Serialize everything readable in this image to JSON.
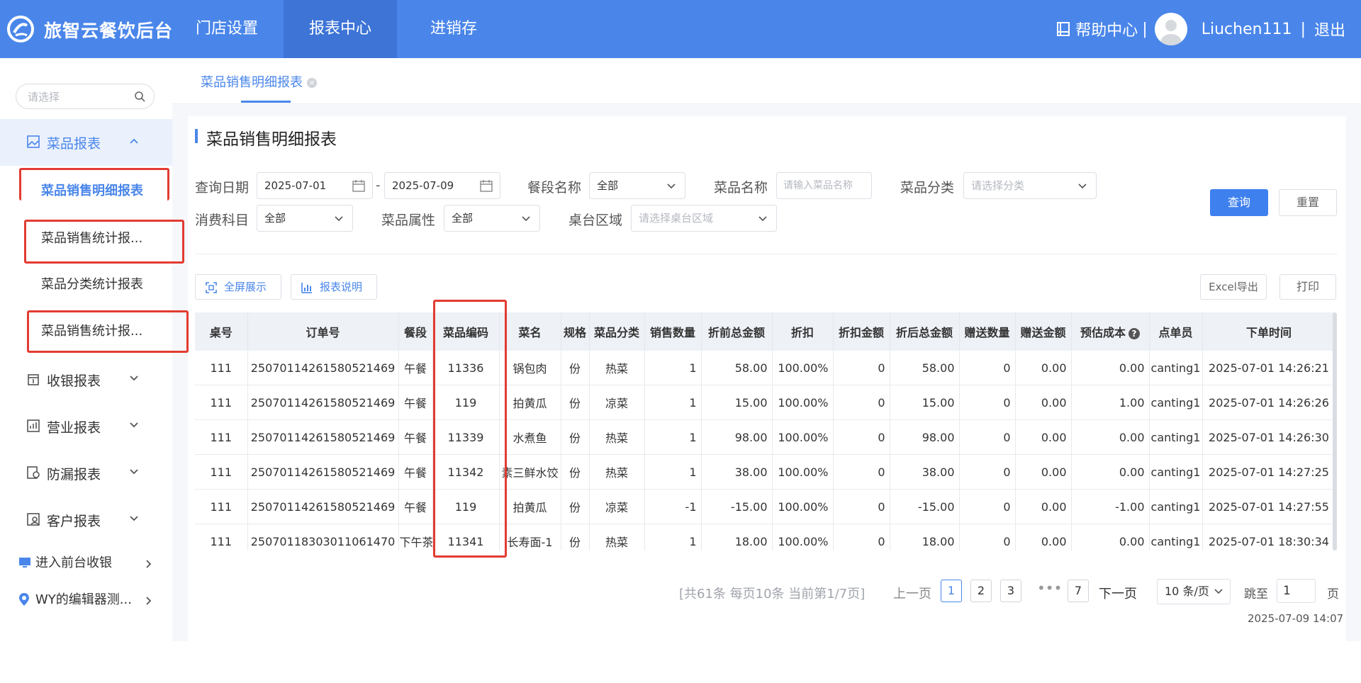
{
  "header": {
    "brand": "旅智云餐饮后台",
    "nav": [
      {
        "label": "门店设置"
      },
      {
        "label": "报表中心"
      },
      {
        "label": "进销存"
      }
    ],
    "help": "帮助中心",
    "sep1": "|",
    "username": "Liuchen111",
    "sep2": "|",
    "logout": "退出",
    "brand_color": "#4a86ea"
  },
  "sidebar": {
    "search_placeholder": "请选择",
    "groups": [
      {
        "label": "菜品报表",
        "icon": "image-report-icon",
        "expanded": true,
        "items": [
          "菜品销售明细报表",
          "菜品销售统计报...",
          "菜品分类统计报表",
          "菜品销售统计报..."
        ]
      },
      {
        "label": "收银报表",
        "icon": "cashier-report-icon"
      },
      {
        "label": "营业报表",
        "icon": "business-report-icon"
      },
      {
        "label": "防漏报表",
        "icon": "leak-report-icon"
      },
      {
        "label": "客户报表",
        "icon": "customer-report-icon"
      }
    ],
    "links": [
      {
        "label": "进入前台收银",
        "icon": "monitor-icon"
      },
      {
        "label": "WY的编辑器测...",
        "icon": "location-pin-icon"
      }
    ]
  },
  "tabs": [
    {
      "label": "菜品销售明细报表"
    }
  ],
  "page": {
    "title": "菜品销售明细报表",
    "filters": {
      "date_label": "查询日期",
      "date_start": "2025-07-01",
      "date_sep": "-",
      "date_end": "2025-07-09",
      "meal_label": "餐段名称",
      "meal_value": "全部",
      "dish_label": "菜品名称",
      "dish_placeholder": "请输入菜品名称",
      "category_label": "菜品分类",
      "category_placeholder": "请选择分类",
      "subject_label": "消费科目",
      "subject_value": "全部",
      "attr_label": "菜品属性",
      "attr_value": "全部",
      "area_label": "桌台区域",
      "area_placeholder": "请选择桌台区域"
    },
    "query_button": "查询",
    "reset_button": "重置",
    "fullscreen_button": "全屏展示",
    "explain_button": "报表说明",
    "excel_button": "Excel导出",
    "print_button": "打印"
  },
  "table": {
    "columns": [
      "桌号",
      "订单号",
      "餐段",
      "菜品编码",
      "菜名",
      "规格",
      "菜品分类",
      "销售数量",
      "折前总金额",
      "折扣",
      "折扣金额",
      "折后总金额",
      "赠送数量",
      "赠送金额",
      "预估成本",
      "点单员",
      "下单时间"
    ],
    "rows": [
      [
        "111",
        "25070114261580521469",
        "午餐",
        "11336",
        "锅包肉",
        "份",
        "热菜",
        "1",
        "58.00",
        "100.00%",
        "0",
        "58.00",
        "0",
        "0.00",
        "0.00",
        "canting1",
        "2025-07-01 14:26:21"
      ],
      [
        "111",
        "25070114261580521469",
        "午餐",
        "119",
        "拍黄瓜",
        "份",
        "凉菜",
        "1",
        "15.00",
        "100.00%",
        "0",
        "15.00",
        "0",
        "0.00",
        "1.00",
        "canting1",
        "2025-07-01 14:26:26"
      ],
      [
        "111",
        "25070114261580521469",
        "午餐",
        "11339",
        "水煮鱼",
        "份",
        "热菜",
        "1",
        "98.00",
        "100.00%",
        "0",
        "98.00",
        "0",
        "0.00",
        "0.00",
        "canting1",
        "2025-07-01 14:26:30"
      ],
      [
        "111",
        "25070114261580521469",
        "午餐",
        "11342",
        "素三鲜水饺",
        "份",
        "热菜",
        "1",
        "38.00",
        "100.00%",
        "0",
        "38.00",
        "0",
        "0.00",
        "0.00",
        "canting1",
        "2025-07-01 14:27:25"
      ],
      [
        "111",
        "25070114261580521469",
        "午餐",
        "119",
        "拍黄瓜",
        "份",
        "凉菜",
        "-1",
        "-15.00",
        "100.00%",
        "0",
        "-15.00",
        "0",
        "0.00",
        "-1.00",
        "canting1",
        "2025-07-01 14:27:55"
      ],
      [
        "111",
        "25070118303011061470",
        "下午茶",
        "11341",
        "长寿面-1",
        "份",
        "热菜",
        "1",
        "18.00",
        "100.00%",
        "0",
        "18.00",
        "0",
        "0.00",
        "0.00",
        "canting1",
        "2025-07-01 18:30:34"
      ]
    ]
  },
  "pagination": {
    "info": "[共61条 每页10条 当前第1/7页]",
    "prev": "上一页",
    "pages": [
      "1",
      "2",
      "3",
      "7"
    ],
    "dots": "•••",
    "next": "下一页",
    "page_size": "10 条/页",
    "jump_label": "跳至",
    "jump_value": "1",
    "page_unit": "页"
  },
  "timestamp": "2025-07-09 14:07"
}
